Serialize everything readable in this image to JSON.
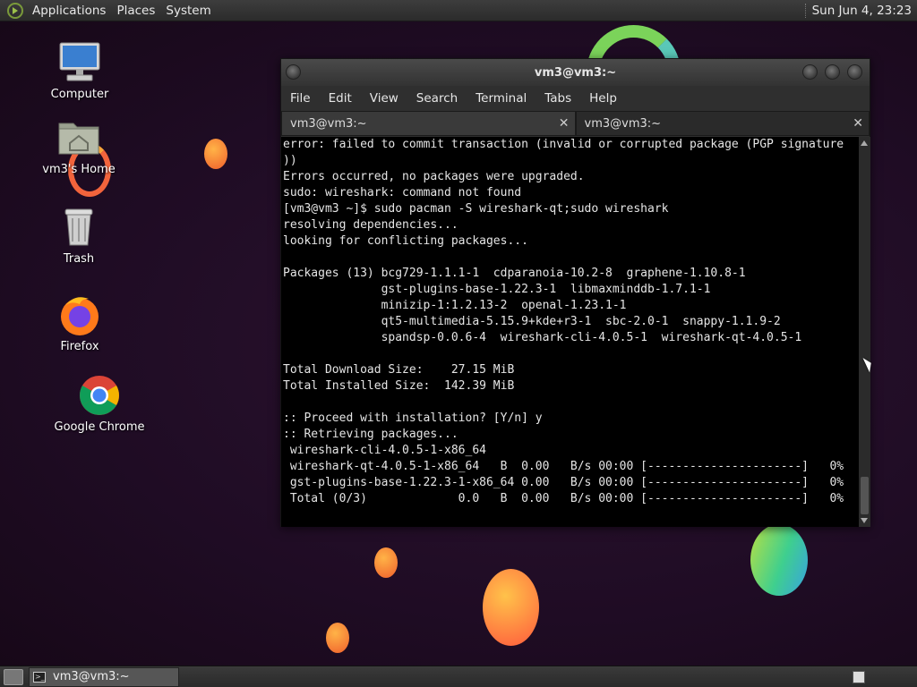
{
  "top_panel": {
    "menus": [
      "Applications",
      "Places",
      "System"
    ],
    "clock": "Sun Jun  4, 23:23"
  },
  "desktop_icons": [
    {
      "label": "Computer",
      "icon": "computer-icon"
    },
    {
      "label": "vm3's Home",
      "icon": "home-folder-icon"
    },
    {
      "label": "Trash",
      "icon": "trash-icon"
    },
    {
      "label": "Firefox",
      "icon": "firefox-icon"
    },
    {
      "label": "Google Chrome",
      "icon": "chrome-icon"
    }
  ],
  "terminal": {
    "title": "vm3@vm3:~",
    "menu": [
      "File",
      "Edit",
      "View",
      "Search",
      "Terminal",
      "Tabs",
      "Help"
    ],
    "tabs": [
      {
        "label": "vm3@vm3:~",
        "active": true
      },
      {
        "label": "vm3@vm3:~",
        "active": false
      }
    ],
    "lines": [
      "error: failed to commit transaction (invalid or corrupted package (PGP signature",
      "))",
      "Errors occurred, no packages were upgraded.",
      "sudo: wireshark: command not found",
      "[vm3@vm3 ~]$ sudo pacman -S wireshark-qt;sudo wireshark",
      "resolving dependencies...",
      "looking for conflicting packages...",
      "",
      "Packages (13) bcg729-1.1.1-1  cdparanoia-10.2-8  graphene-1.10.8-1",
      "              gst-plugins-base-1.22.3-1  libmaxminddb-1.7.1-1",
      "              minizip-1:1.2.13-2  openal-1.23.1-1",
      "              qt5-multimedia-5.15.9+kde+r3-1  sbc-2.0-1  snappy-1.1.9-2",
      "              spandsp-0.0.6-4  wireshark-cli-4.0.5-1  wireshark-qt-4.0.5-1",
      "",
      "Total Download Size:    27.15 MiB",
      "Total Installed Size:  142.39 MiB",
      "",
      ":: Proceed with installation? [Y/n] y",
      ":: Retrieving packages...",
      " wireshark-cli-4.0.5-1-x86_64",
      " wireshark-qt-4.0.5-1-x86_64   B  0.00   B/s 00:00 [----------------------]   0%",
      " gst-plugins-base-1.22.3-1-x86_64 0.00   B/s 00:00 [----------------------]   0%",
      " Total (0/3)             0.0   B  0.00   B/s 00:00 [----------------------]   0%"
    ]
  },
  "taskbar": {
    "window_button": "vm3@vm3:~"
  },
  "colors": {
    "panel": "#2f2f2f",
    "terminal_bg": "#000000",
    "terminal_fg": "#e5e5e5",
    "wallpaper": "#1f0c24"
  }
}
